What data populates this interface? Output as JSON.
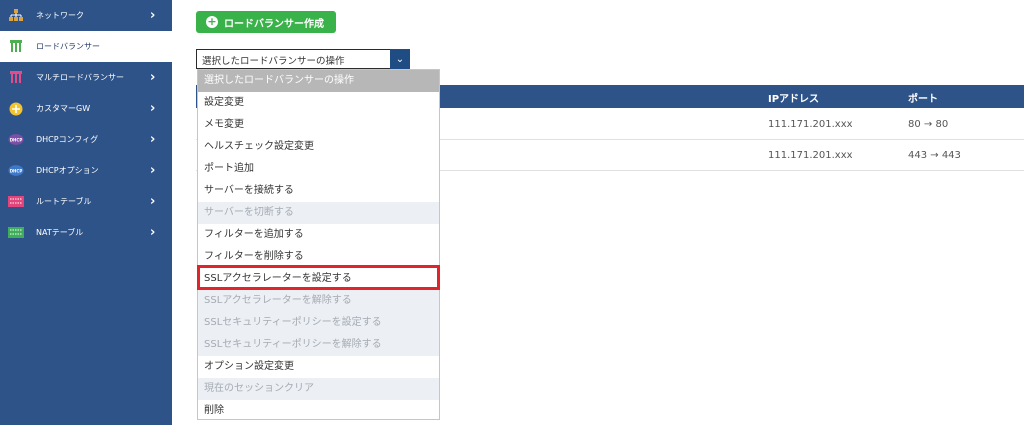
{
  "sidebar": {
    "items": [
      {
        "label": "ネットワーク",
        "icon": "network-icon",
        "has_chevron": true
      },
      {
        "label": "ロードバランサー",
        "icon": "load-balancer-icon",
        "active": true,
        "has_chevron": false
      },
      {
        "label": "マルチロードバランサー",
        "icon": "multi-load-balancer-icon",
        "has_chevron": true
      },
      {
        "label": "カスタマーGW",
        "icon": "customer-gw-icon",
        "has_chevron": true
      },
      {
        "label": "DHCPコンフィグ",
        "icon": "dhcp-icon",
        "has_chevron": true
      },
      {
        "label": "DHCPオプション",
        "icon": "dhcp-icon",
        "has_chevron": true
      },
      {
        "label": "ルートテーブル",
        "icon": "route-table-icon",
        "has_chevron": true
      },
      {
        "label": "NATテーブル",
        "icon": "nat-table-icon",
        "has_chevron": true
      }
    ]
  },
  "toolbar": {
    "create_label": "ロードバランサー作成"
  },
  "action_select": {
    "value": "選択したロードバランサーの操作"
  },
  "table": {
    "headers": {
      "ip": "IPアドレス",
      "port": "ポート"
    },
    "rows": [
      {
        "ip": "111.171.201.xxx",
        "port": "80 → 80"
      },
      {
        "ip": "111.171.201.xxx",
        "port": "443 → 443"
      }
    ]
  },
  "dropdown": {
    "options": [
      {
        "label": "選択したロードバランサーの操作",
        "state": "header"
      },
      {
        "label": "設定変更",
        "state": "enabled"
      },
      {
        "label": "メモ変更",
        "state": "enabled"
      },
      {
        "label": "ヘルスチェック設定変更",
        "state": "enabled"
      },
      {
        "label": "ポート追加",
        "state": "enabled"
      },
      {
        "label": "サーバーを接続する",
        "state": "enabled"
      },
      {
        "label": "サーバーを切断する",
        "state": "disabled"
      },
      {
        "label": "フィルターを追加する",
        "state": "enabled"
      },
      {
        "label": "フィルターを削除する",
        "state": "enabled"
      },
      {
        "label": "SSLアクセラレーターを設定する",
        "state": "enabled",
        "highlighted": true
      },
      {
        "label": "SSLアクセラレーターを解除する",
        "state": "disabled"
      },
      {
        "label": "SSLセキュリティーポリシーを設定する",
        "state": "disabled"
      },
      {
        "label": "SSLセキュリティーポリシーを解除する",
        "state": "disabled"
      },
      {
        "label": "オプション設定変更",
        "state": "enabled"
      },
      {
        "label": "現在のセッションクリア",
        "state": "disabled"
      },
      {
        "label": "削除",
        "state": "enabled"
      }
    ]
  },
  "colors": {
    "sidebar": "#2e5389",
    "accent_green": "#3ab24a",
    "highlight_red": "#e0252a"
  }
}
